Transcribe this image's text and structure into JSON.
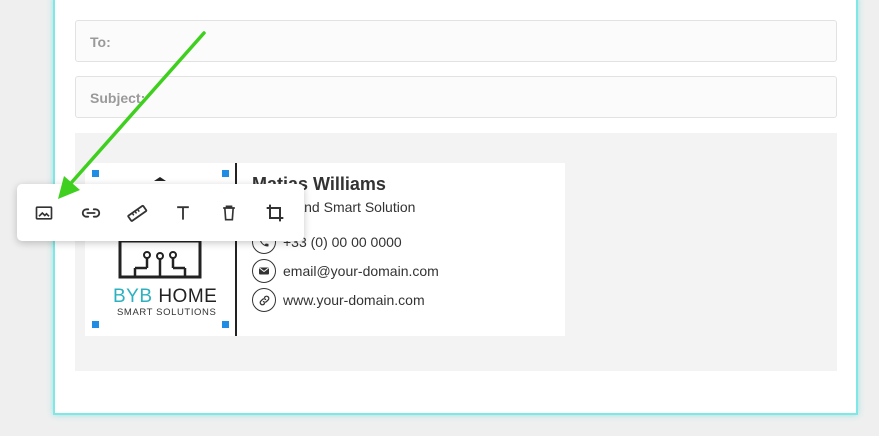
{
  "compose": {
    "to_label": "To:",
    "subject_label": "Subject:"
  },
  "signature": {
    "name": "Matias Williams",
    "role": "at Bybrand Smart Solution",
    "phone": "+33 (0) 00 00 0000",
    "email": "email@your-domain.com",
    "website": "www.your-domain.com",
    "logo": {
      "brand_part1": "BYB",
      "brand_part2": "HOME",
      "tagline": "SMART SOLUTIONS"
    }
  },
  "toolbar": {
    "items": [
      {
        "icon": "image-icon"
      },
      {
        "icon": "link-icon"
      },
      {
        "icon": "ruler-icon"
      },
      {
        "icon": "text-icon"
      },
      {
        "icon": "trash-icon"
      },
      {
        "icon": "crop-icon"
      }
    ]
  },
  "colors": {
    "accent_border": "#7ee8e6",
    "handle": "#1e8de3",
    "brand_teal": "#2bb1c0",
    "arrow": "#3fcf1e"
  }
}
